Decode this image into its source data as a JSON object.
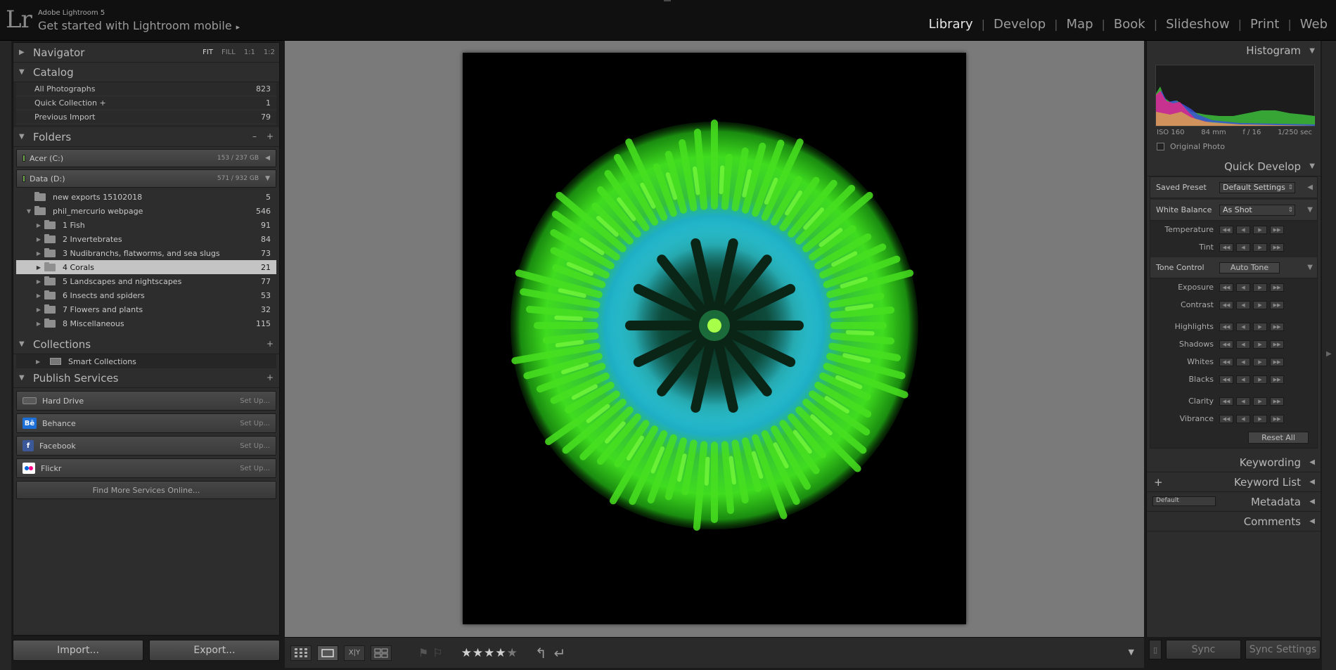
{
  "app": {
    "logo": "Lr",
    "title": "Adobe Lightroom 5",
    "mobile_prompt": "Get started with Lightroom mobile",
    "mobile_arrow": "▸"
  },
  "modules": {
    "library": "Library",
    "develop": "Develop",
    "map": "Map",
    "book": "Book",
    "slideshow": "Slideshow",
    "print": "Print",
    "web": "Web",
    "separator": "|"
  },
  "navigator": {
    "label": "Navigator",
    "modes": [
      "FIT",
      "FILL",
      "1:1",
      "1:2"
    ]
  },
  "catalog": {
    "label": "Catalog",
    "items": [
      {
        "label": "All Photographs",
        "count": "823"
      },
      {
        "label": "Quick Collection  +",
        "count": "1"
      },
      {
        "label": "Previous Import",
        "count": "79"
      }
    ]
  },
  "folders": {
    "label": "Folders",
    "minus": "–",
    "plus": "+",
    "volumes": [
      {
        "label": "Acer (C:)",
        "size": "153 / 237 GB"
      },
      {
        "label": "Data (D:)",
        "size": "571 / 932 GB"
      }
    ],
    "items": [
      {
        "label": "new exports 15102018",
        "count": "5"
      },
      {
        "label": "phil_mercurio webpage",
        "count": "546"
      },
      {
        "label": "1 Fish",
        "count": "91"
      },
      {
        "label": "2 Invertebrates",
        "count": "84"
      },
      {
        "label": "3 Nudibranchs, flatworms, and  sea slugs",
        "count": "73"
      },
      {
        "label": "4 Corals",
        "count": "21"
      },
      {
        "label": "5 Landscapes and nightscapes",
        "count": "77"
      },
      {
        "label": "6 Insects and spiders",
        "count": "53"
      },
      {
        "label": "7 Flowers and plants",
        "count": "32"
      },
      {
        "label": "8 Miscellaneous",
        "count": "115"
      }
    ]
  },
  "collections": {
    "label": "Collections",
    "plus": "+",
    "items": [
      {
        "label": "Smart Collections"
      }
    ]
  },
  "publish": {
    "label": "Publish Services",
    "plus": "+",
    "services": [
      {
        "label": "Hard Drive",
        "action": "Set Up..."
      },
      {
        "label": "Behance",
        "action": "Set Up...",
        "icon_text": "Bē"
      },
      {
        "label": "Facebook",
        "action": "Set Up...",
        "icon_text": "f"
      },
      {
        "label": "Flickr",
        "action": "Set Up...",
        "icon_text": "●●"
      }
    ],
    "find_more": "Find More Services Online..."
  },
  "left_buttons": {
    "import": "Import...",
    "export": "Export..."
  },
  "toolbar": {
    "rating_stars": 4,
    "stars_filled": "★★★★",
    "stars_empty": "★"
  },
  "histogram": {
    "label": "Histogram",
    "iso": "ISO 160",
    "focal": "84 mm",
    "aperture": "f / 16",
    "shutter": "1/250 sec",
    "original_photo": "Original Photo"
  },
  "quick_develop": {
    "label": "Quick Develop",
    "saved_preset_label": "Saved Preset",
    "saved_preset_value": "Default Settings",
    "white_balance_label": "White Balance",
    "white_balance_value": "As Shot",
    "wb_adjust": [
      "Temperature",
      "Tint"
    ],
    "tone_control_label": "Tone Control",
    "auto_tone": "Auto Tone",
    "tone_group1": [
      "Exposure",
      "Contrast"
    ],
    "tone_group2": [
      "Highlights",
      "Shadows",
      "Whites",
      "Blacks"
    ],
    "presence": [
      "Clarity",
      "Vibrance"
    ],
    "reset_all": "Reset All"
  },
  "right_sections": {
    "keywording": "Keywording",
    "keyword_list": "Keyword List",
    "keyword_plus": "+",
    "metadata": "Metadata",
    "metadata_preset": "Default",
    "comments": "Comments"
  },
  "right_buttons": {
    "sync": "Sync",
    "sync_settings": "Sync Settings"
  }
}
